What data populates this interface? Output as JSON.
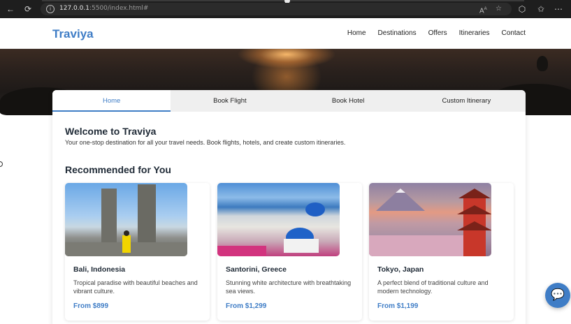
{
  "browser": {
    "url_host": "127.0.0.1",
    "url_path": ":5500/index.html#",
    "reader_label": "A",
    "reader_sup": "A"
  },
  "site": {
    "logo": "Traviya",
    "nav": [
      "Home",
      "Destinations",
      "Offers",
      "Itineraries",
      "Contact"
    ]
  },
  "tabs": [
    "Home",
    "Book Flight",
    "Book Hotel",
    "Custom Itinerary"
  ],
  "welcome": {
    "title": "Welcome to Traviya",
    "text": "Your one-stop destination for all your travel needs. Book flights, hotels, and create custom itineraries."
  },
  "recommended": {
    "title": "Recommended for You",
    "items": [
      {
        "name": "Bali, Indonesia",
        "desc": "Tropical paradise with beautiful beaches and vibrant culture.",
        "price": "From $899"
      },
      {
        "name": "Santorini, Greece",
        "desc": "Stunning white architecture with breathtaking sea views.",
        "price": "From $1,299"
      },
      {
        "name": "Tokyo, Japan",
        "desc": "A perfect blend of traditional culture and modern technology.",
        "price": "From $1,199"
      }
    ]
  },
  "colors": {
    "accent": "#3f7dc6",
    "text_dark": "#1f2a36"
  },
  "icons": {
    "chat": "chat-bubbles-icon"
  }
}
